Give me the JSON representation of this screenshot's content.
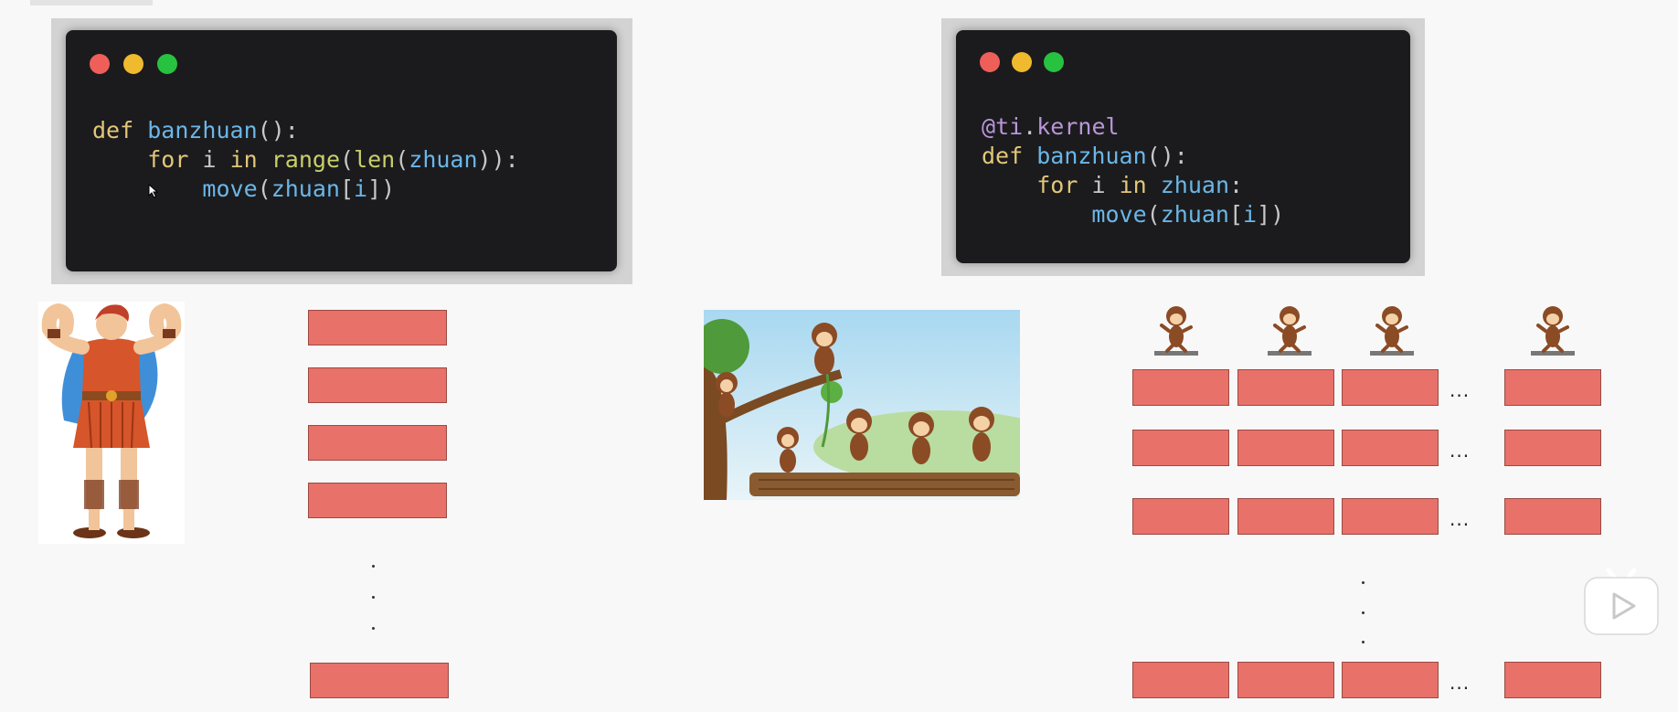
{
  "left_code": {
    "line1": {
      "kw_def": "def",
      "fn": "banzhuan",
      "rest": "():"
    },
    "line2": {
      "kw_for": "for",
      "v_i": "i",
      "kw_in": "in",
      "bi_range": "range",
      "p1": "(",
      "bi_len": "len",
      "p2": "(",
      "v_zhuan": "zhuan",
      "rest": ")):"
    },
    "line3": {
      "fn_move": "move",
      "p1": "(",
      "v_zhuan": "zhuan",
      "p2": "[",
      "v_i": "i",
      "rest": "])"
    }
  },
  "right_code": {
    "line1": {
      "at": "@",
      "ti": "ti",
      "dot": ".",
      "kernel": "kernel"
    },
    "line2": {
      "kw_def": "def",
      "fn": "banzhuan",
      "rest": "():"
    },
    "line3": {
      "kw_for": "for",
      "v_i": "i",
      "kw_in": "in",
      "v_zhuan": "zhuan",
      "rest": ":"
    },
    "line4": {
      "fn_move": "move",
      "p1": "(",
      "v_zhuan": "zhuan",
      "p2": "[",
      "v_i": "i",
      "rest": "])"
    }
  },
  "ellipsis": "...",
  "colors": {
    "brick": "#e87169",
    "code_bg": "#1b1b1d",
    "keyword": "#e2c779",
    "function": "#6bb6e8",
    "builtin": "#c9cf6b",
    "decorator": "#b896d8"
  },
  "icons": [
    "cursor-arrow-icon",
    "play-icon",
    "tv-antenna-icon"
  ]
}
